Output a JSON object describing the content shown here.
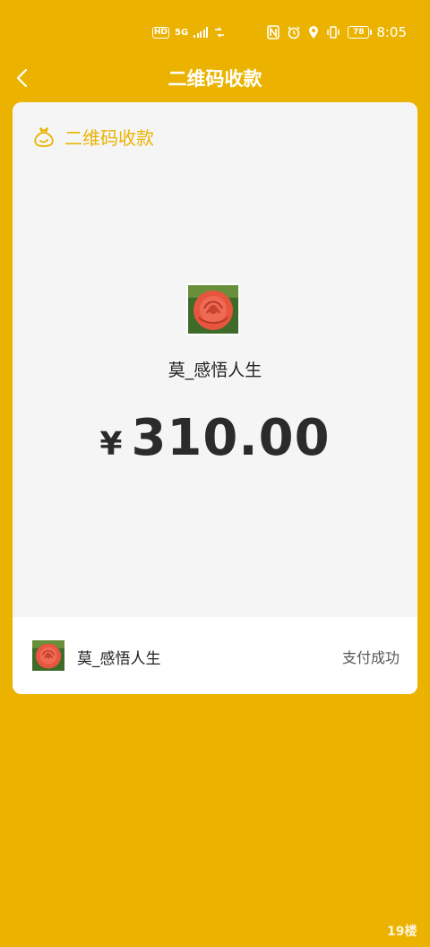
{
  "status_bar": {
    "hd": "HD",
    "network": "5G",
    "time": "8:05",
    "battery": "78"
  },
  "header": {
    "title": "二维码收款"
  },
  "card": {
    "title": "二维码收款",
    "payer_name": "莫_感悟人生",
    "currency_symbol": "¥",
    "amount": "310.00"
  },
  "record": {
    "name": "莫_感悟人生",
    "status": "支付成功"
  },
  "watermark": "19楼",
  "colors": {
    "background": "#EBB300",
    "accent": "#EBB300",
    "card": "#FFFFFF",
    "card_top": "#F5F5F5"
  },
  "icons": [
    "back-chevron-icon",
    "money-bag-icon",
    "rose-avatar",
    "nfc-icon",
    "alarm-icon",
    "location-icon",
    "vibrate-icon"
  ]
}
